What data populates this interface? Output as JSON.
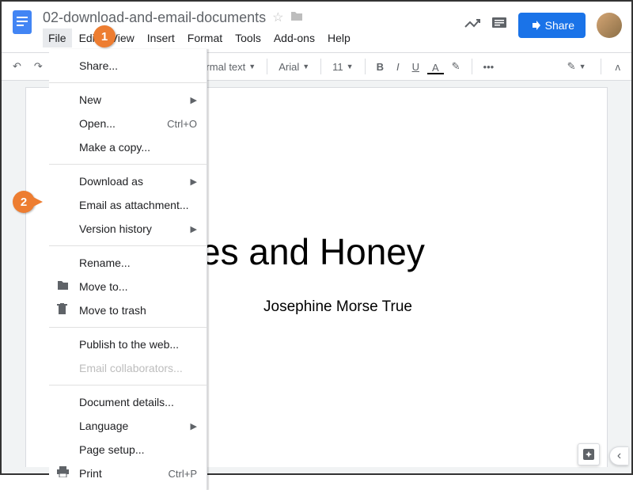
{
  "header": {
    "doc_title": "02-download-and-email-documents",
    "share_label": "Share"
  },
  "menubar": {
    "items": [
      "File",
      "Edit",
      "View",
      "Insert",
      "Format",
      "Tools",
      "Add-ons",
      "Help"
    ]
  },
  "toolbar": {
    "style_select": "Normal text",
    "font_select": "Arial",
    "font_size": "11",
    "more": "•••"
  },
  "file_menu": {
    "share": "Share...",
    "new": "New",
    "open": "Open...",
    "open_shortcut": "Ctrl+O",
    "make_copy": "Make a copy...",
    "download_as": "Download as",
    "email_attachment": "Email as attachment...",
    "version_history": "Version history",
    "rename": "Rename...",
    "move_to": "Move to...",
    "move_to_trash": "Move to trash",
    "publish": "Publish to the web...",
    "email_collab": "Email collaborators...",
    "doc_details": "Document details...",
    "language": "Language",
    "page_setup": "Page setup...",
    "print": "Print",
    "print_shortcut": "Ctrl+P"
  },
  "document": {
    "title_visible": "es and Honey",
    "subtitle": "Josephine Morse True"
  },
  "callouts": {
    "c1": "1",
    "c2": "2"
  }
}
